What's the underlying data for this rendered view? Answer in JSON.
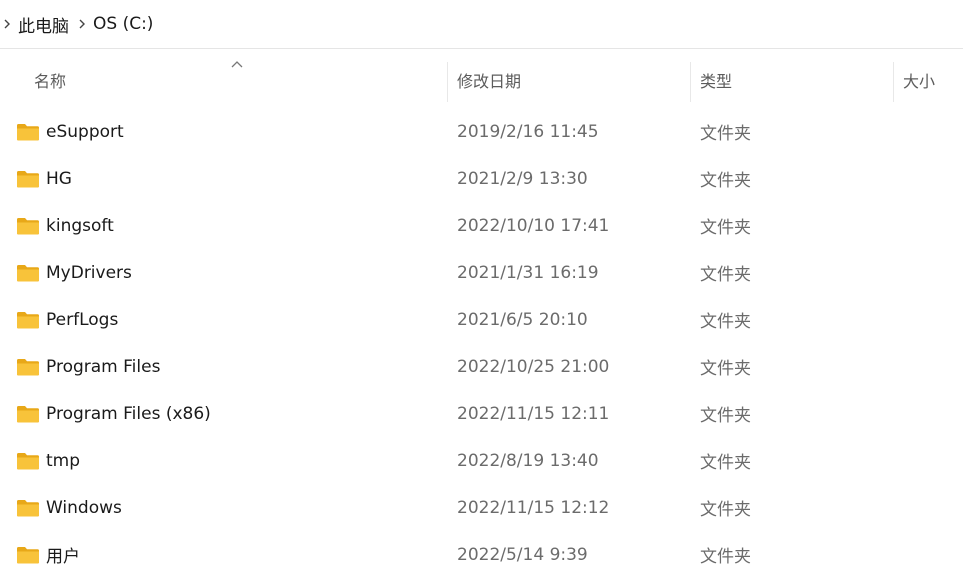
{
  "breadcrumb": {
    "items": [
      {
        "label": "此电脑"
      },
      {
        "label": "OS (C:)"
      }
    ]
  },
  "columns": {
    "name": "名称",
    "modified": "修改日期",
    "type": "类型",
    "size": "大小"
  },
  "sort": {
    "column": "name",
    "direction": "ascending"
  },
  "colors": {
    "folder": "#f8c33a",
    "folder_dark": "#e8a818",
    "text": "#1a1a1a",
    "muted": "#6b6b6b"
  },
  "files": [
    {
      "name": "eSupport",
      "modified": "2019/2/16 11:45",
      "type": "文件夹",
      "size": "",
      "icon": "folder-icon"
    },
    {
      "name": "HG",
      "modified": "2021/2/9 13:30",
      "type": "文件夹",
      "size": "",
      "icon": "folder-icon"
    },
    {
      "name": "kingsoft",
      "modified": "2022/10/10 17:41",
      "type": "文件夹",
      "size": "",
      "icon": "folder-icon"
    },
    {
      "name": "MyDrivers",
      "modified": "2021/1/31 16:19",
      "type": "文件夹",
      "size": "",
      "icon": "folder-icon"
    },
    {
      "name": "PerfLogs",
      "modified": "2021/6/5 20:10",
      "type": "文件夹",
      "size": "",
      "icon": "folder-icon"
    },
    {
      "name": "Program Files",
      "modified": "2022/10/25 21:00",
      "type": "文件夹",
      "size": "",
      "icon": "folder-icon"
    },
    {
      "name": "Program Files (x86)",
      "modified": "2022/11/15 12:11",
      "type": "文件夹",
      "size": "",
      "icon": "folder-icon"
    },
    {
      "name": "tmp",
      "modified": "2022/8/19 13:40",
      "type": "文件夹",
      "size": "",
      "icon": "folder-icon"
    },
    {
      "name": "Windows",
      "modified": "2022/11/15 12:12",
      "type": "文件夹",
      "size": "",
      "icon": "folder-icon"
    },
    {
      "name": "用户",
      "modified": "2022/5/14 9:39",
      "type": "文件夹",
      "size": "",
      "icon": "folder-icon"
    }
  ]
}
